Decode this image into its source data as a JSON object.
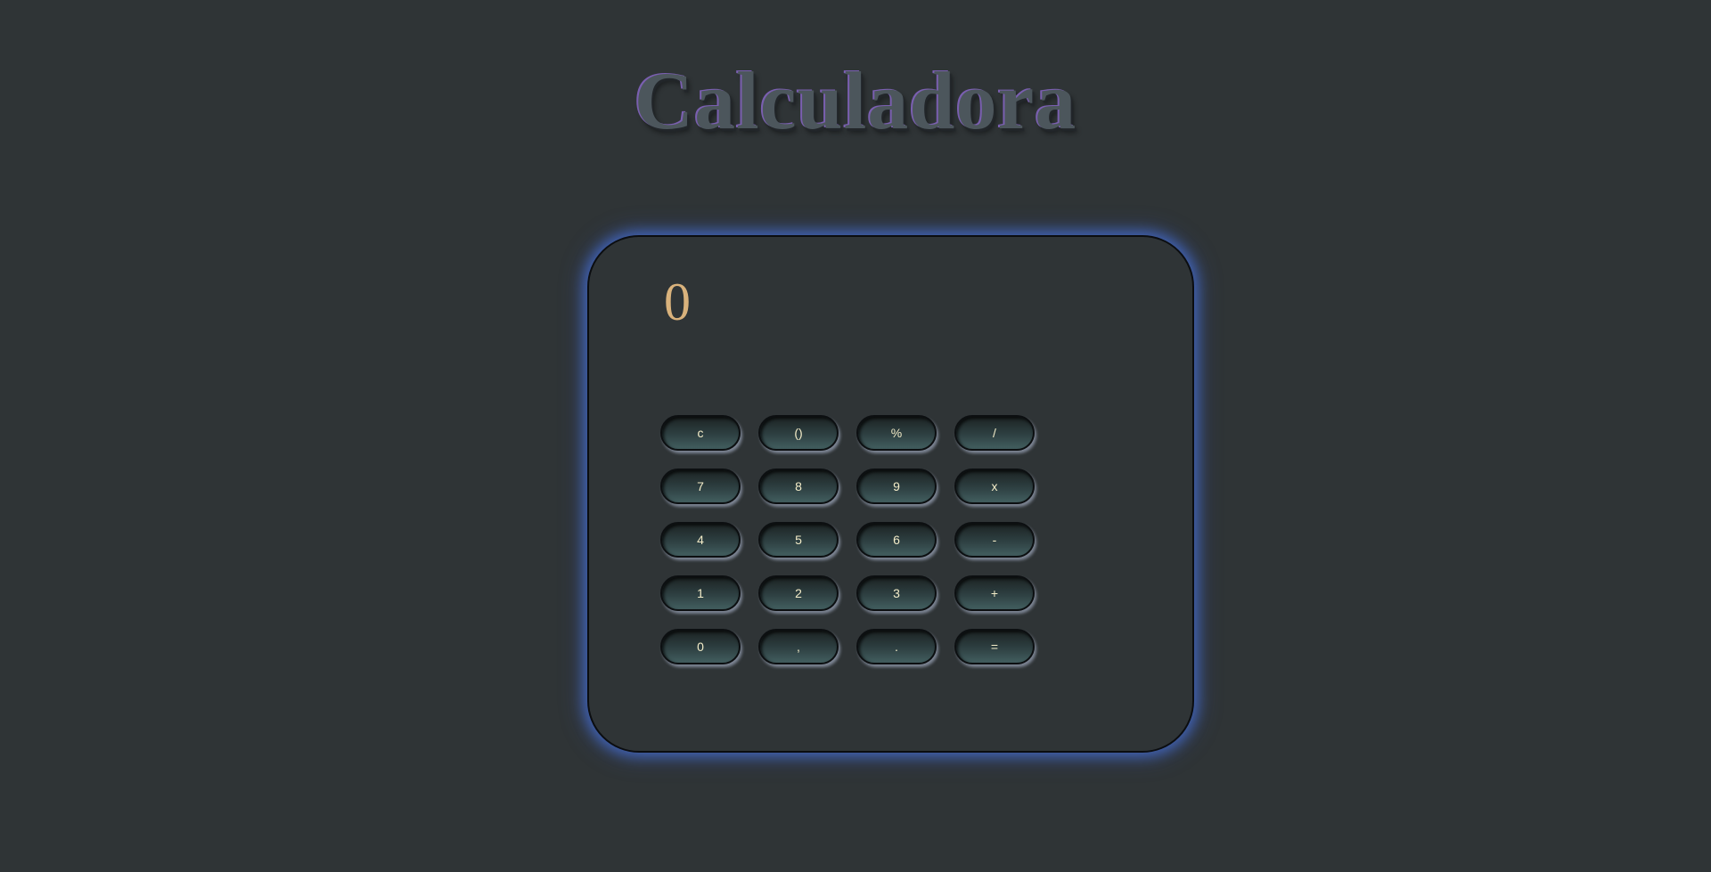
{
  "header": {
    "title": "Calculadora"
  },
  "calculator": {
    "display_value": "0",
    "keys": [
      {
        "label": "c",
        "name": "clear-button"
      },
      {
        "label": "()",
        "name": "parentheses-button"
      },
      {
        "label": "%",
        "name": "percent-button"
      },
      {
        "label": "/",
        "name": "divide-button"
      },
      {
        "label": "7",
        "name": "digit-7-button"
      },
      {
        "label": "8",
        "name": "digit-8-button"
      },
      {
        "label": "9",
        "name": "digit-9-button"
      },
      {
        "label": "x",
        "name": "multiply-button"
      },
      {
        "label": "4",
        "name": "digit-4-button"
      },
      {
        "label": "5",
        "name": "digit-5-button"
      },
      {
        "label": "6",
        "name": "digit-6-button"
      },
      {
        "label": "-",
        "name": "subtract-button"
      },
      {
        "label": "1",
        "name": "digit-1-button"
      },
      {
        "label": "2",
        "name": "digit-2-button"
      },
      {
        "label": "3",
        "name": "digit-3-button"
      },
      {
        "label": "+",
        "name": "add-button"
      },
      {
        "label": "0",
        "name": "digit-0-button"
      },
      {
        "label": ",",
        "name": "comma-button"
      },
      {
        "label": ".",
        "name": "decimal-point-button"
      },
      {
        "label": "=",
        "name": "equals-button"
      }
    ]
  },
  "colors": {
    "background": "#2f3436",
    "display_text": "#d9b27c",
    "key_text": "#f3ecc8",
    "glow": "#466ed2",
    "title_text": "#4c565c",
    "title_accent": "#7a5fb0"
  }
}
